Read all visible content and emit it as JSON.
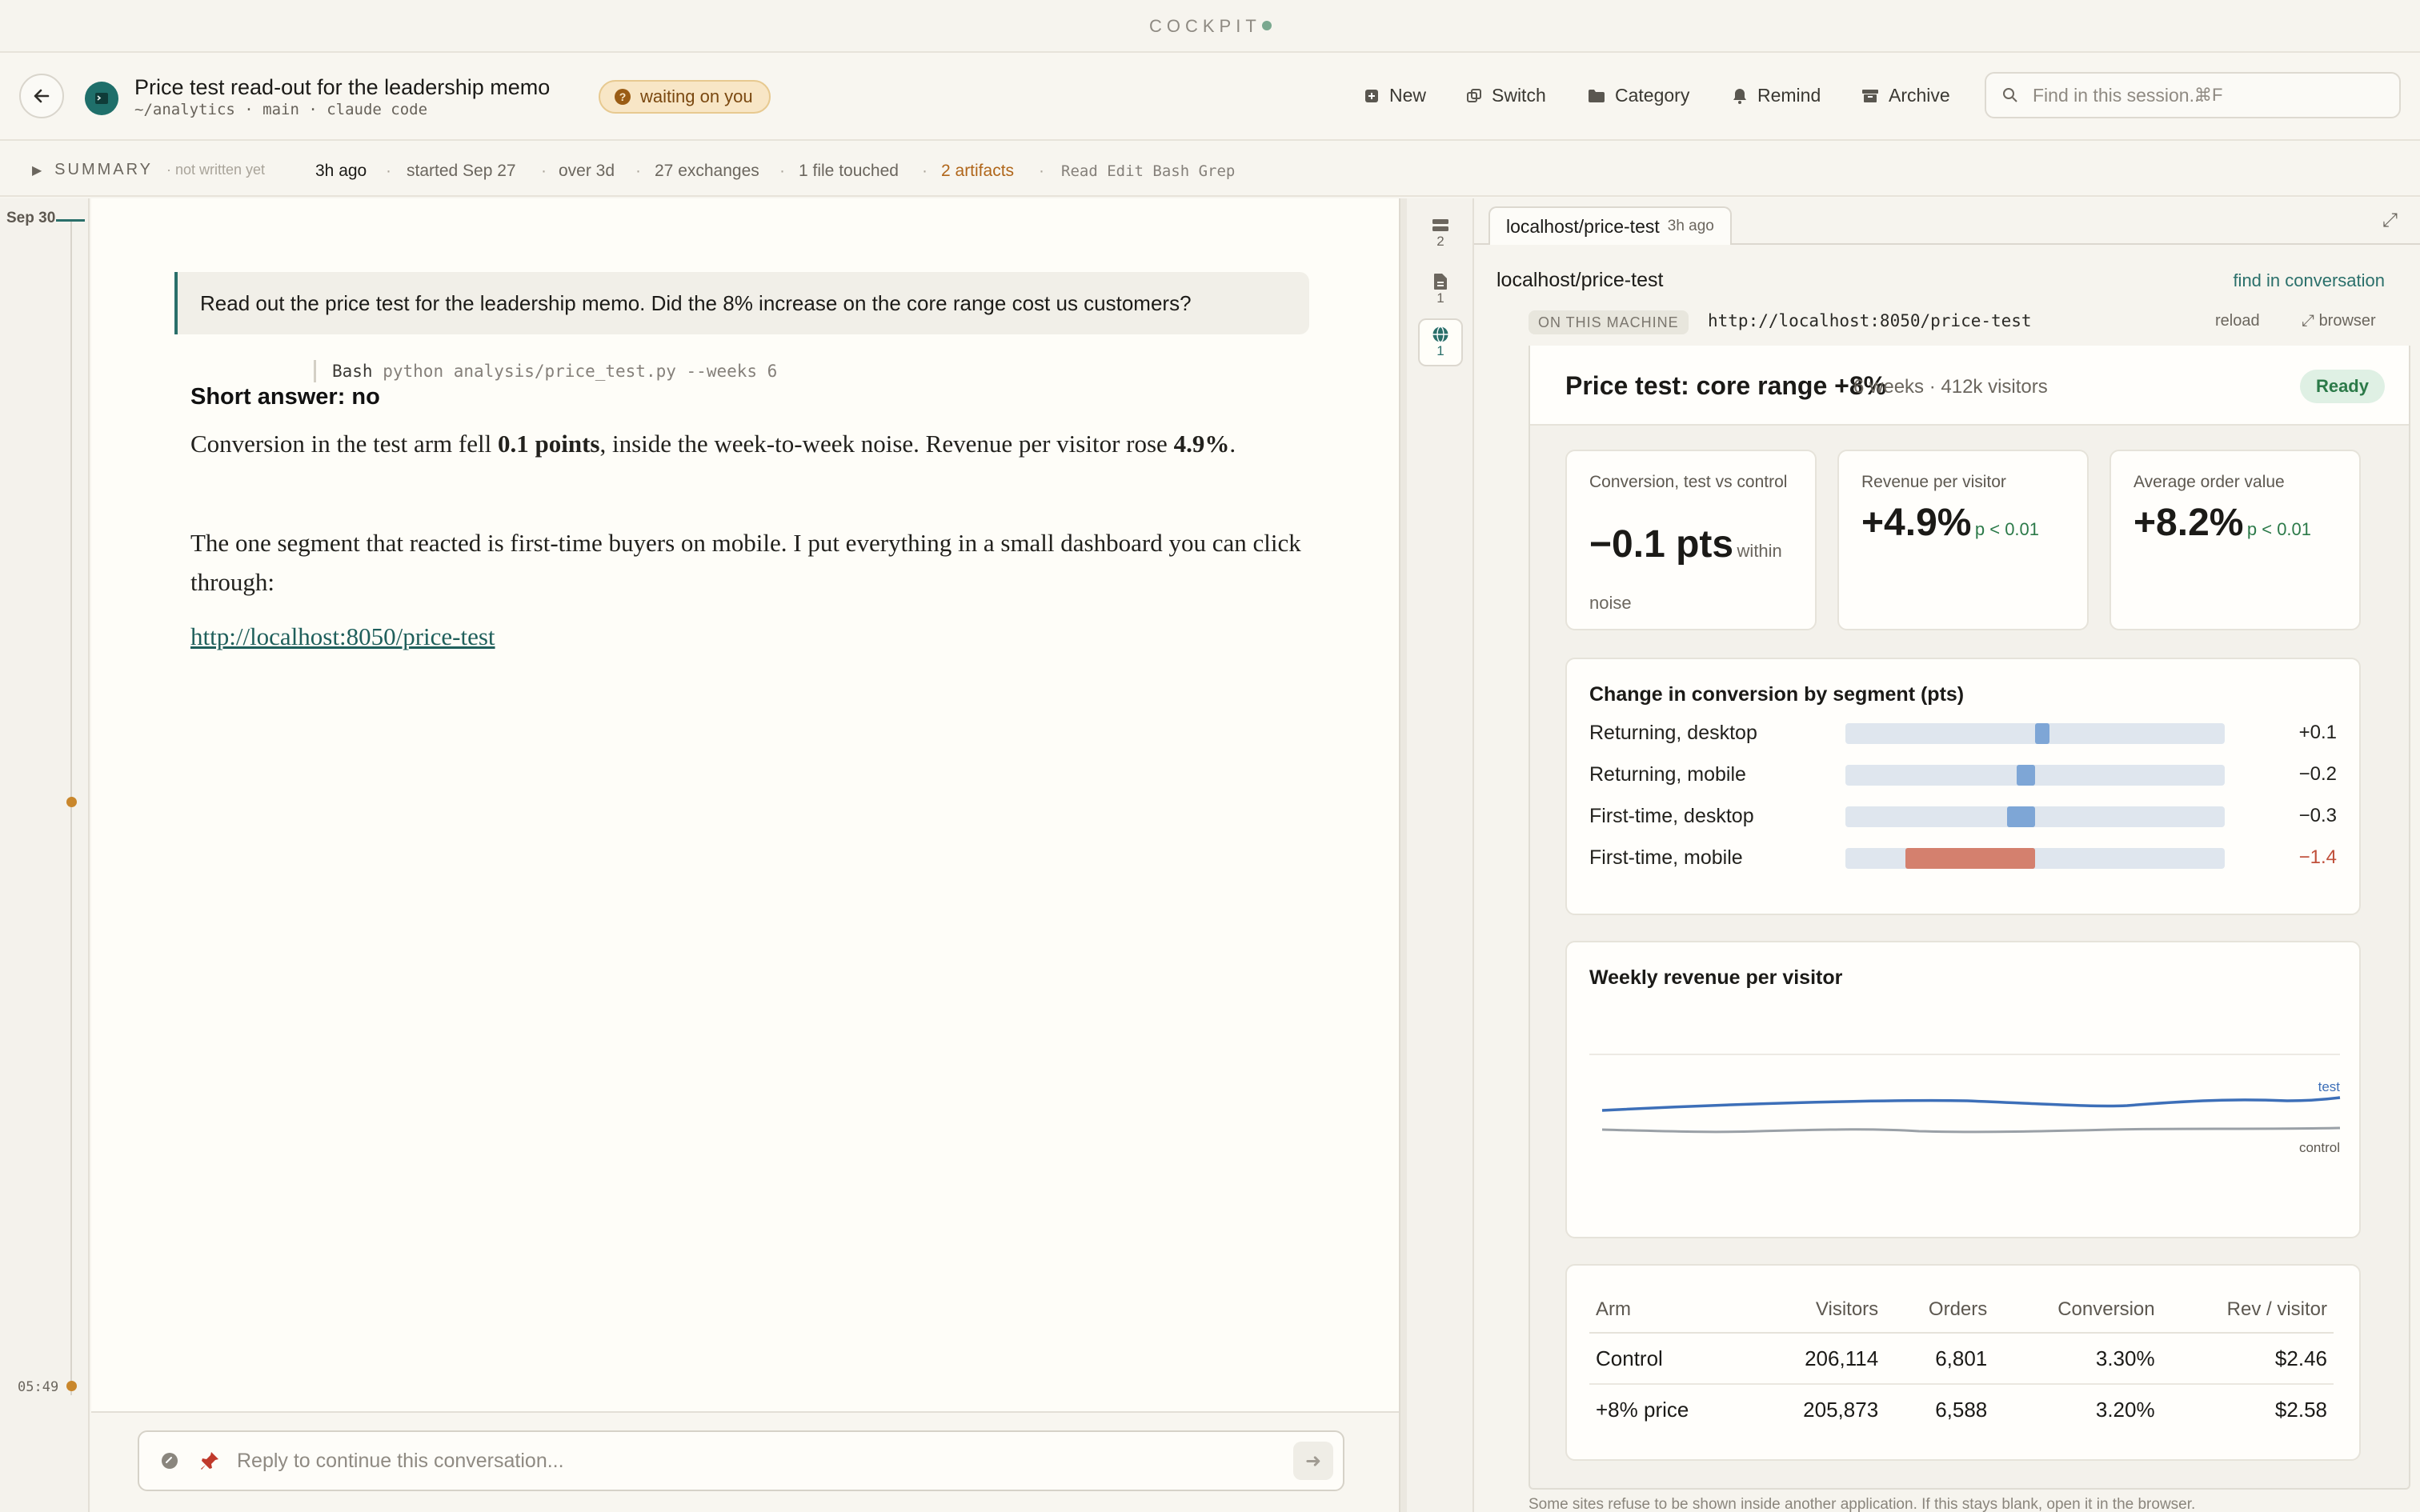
{
  "topbar": {
    "brand": "COCKPIT"
  },
  "header": {
    "title": "Price test read-out for the leadership memo",
    "subtitle": "~/analytics · main · claude code",
    "status": "waiting on you",
    "actions": {
      "new": "New",
      "switch": "Switch",
      "category": "Category",
      "remind": "Remind",
      "archive": "Archive"
    },
    "search": {
      "placeholder": "Find in this session...",
      "shortcut": "⌘F"
    }
  },
  "summary": {
    "label": "SUMMARY",
    "note": "not written yet",
    "last_active": "3h ago",
    "started": "started Sep 27",
    "duration": "over 3d",
    "exchanges": "27 exchanges",
    "files": "1 file touched",
    "artifacts": "2 artifacts",
    "tools": "Read Edit Bash Grep"
  },
  "timeline": {
    "date": "Sep 30",
    "time": "05:49"
  },
  "conversation": {
    "user_message": "Read out the price test for the leadership memo. Did the 8% increase on the core range cost us customers?",
    "tool_name": "Bash",
    "tool_command": "python analysis/price_test.py --weeks 6",
    "answer_title": "Short answer: no",
    "p1_a": "Conversion in the test arm fell ",
    "p1_b": "0.1 points",
    "p1_c": ", inside the week-to-week noise. Revenue per visitor rose ",
    "p1_d": "4.9%",
    "p1_e": ".",
    "p2": "The one segment that reacted is first-time buyers on mobile. I put everything in a small dashboard you can click through:",
    "link": "http://localhost:8050/price-test"
  },
  "composer": {
    "placeholder": "Reply to continue this conversation..."
  },
  "rail": {
    "items": [
      {
        "icon": "list-icon",
        "count": "2"
      },
      {
        "icon": "file-icon",
        "count": "1"
      },
      {
        "icon": "globe-icon",
        "count": "1"
      }
    ]
  },
  "artifact": {
    "tab_title": "localhost/price-test",
    "tab_ago": "3h ago",
    "title": "localhost/price-test",
    "find_link": "find in conversation",
    "machine_label": "ON THIS MACHINE",
    "url": "http://localhost:8050/price-test",
    "reload": "reload",
    "browser": "browser",
    "note": "Some sites refuse to be shown inside another application. If this stays blank, open it in the browser."
  },
  "dashboard": {
    "title": "Price test: core range +8%",
    "meta": "6 weeks · 412k visitors",
    "status": "Ready",
    "kpis": [
      {
        "label": "Conversion, test vs control",
        "value": "−0.1 pts",
        "note": "within noise"
      },
      {
        "label": "Revenue per visitor",
        "value": "+4.9%",
        "p": "p < 0.01"
      },
      {
        "label": "Average order value",
        "value": "+8.2%",
        "p": "p < 0.01"
      }
    ],
    "segments": {
      "title": "Change in conversion by segment (pts)",
      "rows": [
        {
          "label": "Returning, desktop",
          "display": "+0.1",
          "value": 0.1
        },
        {
          "label": "Returning, mobile",
          "display": "−0.2",
          "value": -0.2
        },
        {
          "label": "First-time, desktop",
          "display": "−0.3",
          "value": -0.3
        },
        {
          "label": "First-time, mobile",
          "display": "−1.4",
          "value": -1.4
        }
      ]
    },
    "weekly": {
      "title": "Weekly revenue per visitor",
      "test_label": "test",
      "control_label": "control"
    },
    "table": {
      "headers": [
        "Arm",
        "Visitors",
        "Orders",
        "Conversion",
        "Rev / visitor"
      ],
      "rows": [
        [
          "Control",
          "206,114",
          "6,801",
          "3.30%",
          "$2.46"
        ],
        [
          "+8% price",
          "205,873",
          "6,588",
          "3.20%",
          "$2.58"
        ]
      ]
    }
  },
  "colors": {
    "accent": "#2a6f6a",
    "warning": "#c9872c",
    "test_line": "#3d6fb8",
    "control_line": "#9aa0a6",
    "negative": "#d4806e",
    "positive": "#7ea6d6"
  }
}
